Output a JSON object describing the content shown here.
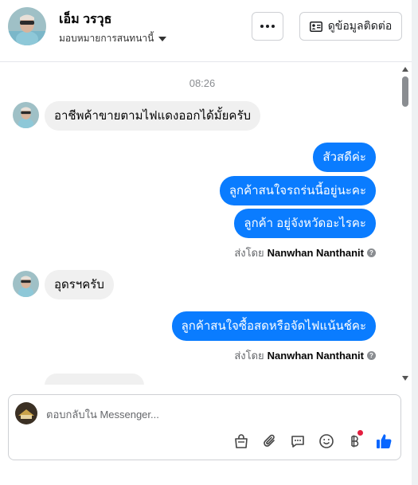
{
  "header": {
    "contact_name": "เอ็ม วรวุธ",
    "assign_label": "มอบหมายการสนทนานี้",
    "more_button_label": "more-options",
    "contact_button_label": "ดูข้อมูลติดต่อ"
  },
  "chat": {
    "timestamp": "08:26",
    "messages": [
      {
        "dir": "in",
        "text": "อาชีพค้าขายตามไฟแดงออกได้มั้ยครับ"
      },
      {
        "dir": "out",
        "text": "สัวสดีค่ะ"
      },
      {
        "dir": "out",
        "text": "ลูกค้าสนใจรถร่นนี้อยู่นะคะ"
      },
      {
        "dir": "out",
        "text": "ลูกค้า  อยู่จังหวัดอะไรคะ"
      },
      {
        "dir": "in",
        "text": "อุดรฯครับ"
      },
      {
        "dir": "out",
        "text": "ลูกค้าสนใจซื้อสดหรือจัดไฟแน้นช์คะ"
      }
    ],
    "sent_by_1": {
      "prefix": "ส่งโดย",
      "name": "Nanwhan Nanthanit"
    },
    "sent_by_2": {
      "prefix": "ส่งโดย",
      "name": "Nanwhan Nanthanit"
    },
    "help_icon": "?"
  },
  "composer": {
    "placeholder": "ตอบกลับใน Messenger...",
    "tools": [
      "shopping-bag-icon",
      "paperclip-icon",
      "saved-reply-icon",
      "emoji-icon",
      "baht-payment-icon",
      "thumbs-up-icon"
    ]
  },
  "colors": {
    "outgoing_bubble": "#0a7cff",
    "incoming_bubble": "#f0f0f0",
    "like_blue": "#0866ff",
    "notification_red": "#e41e3f"
  }
}
